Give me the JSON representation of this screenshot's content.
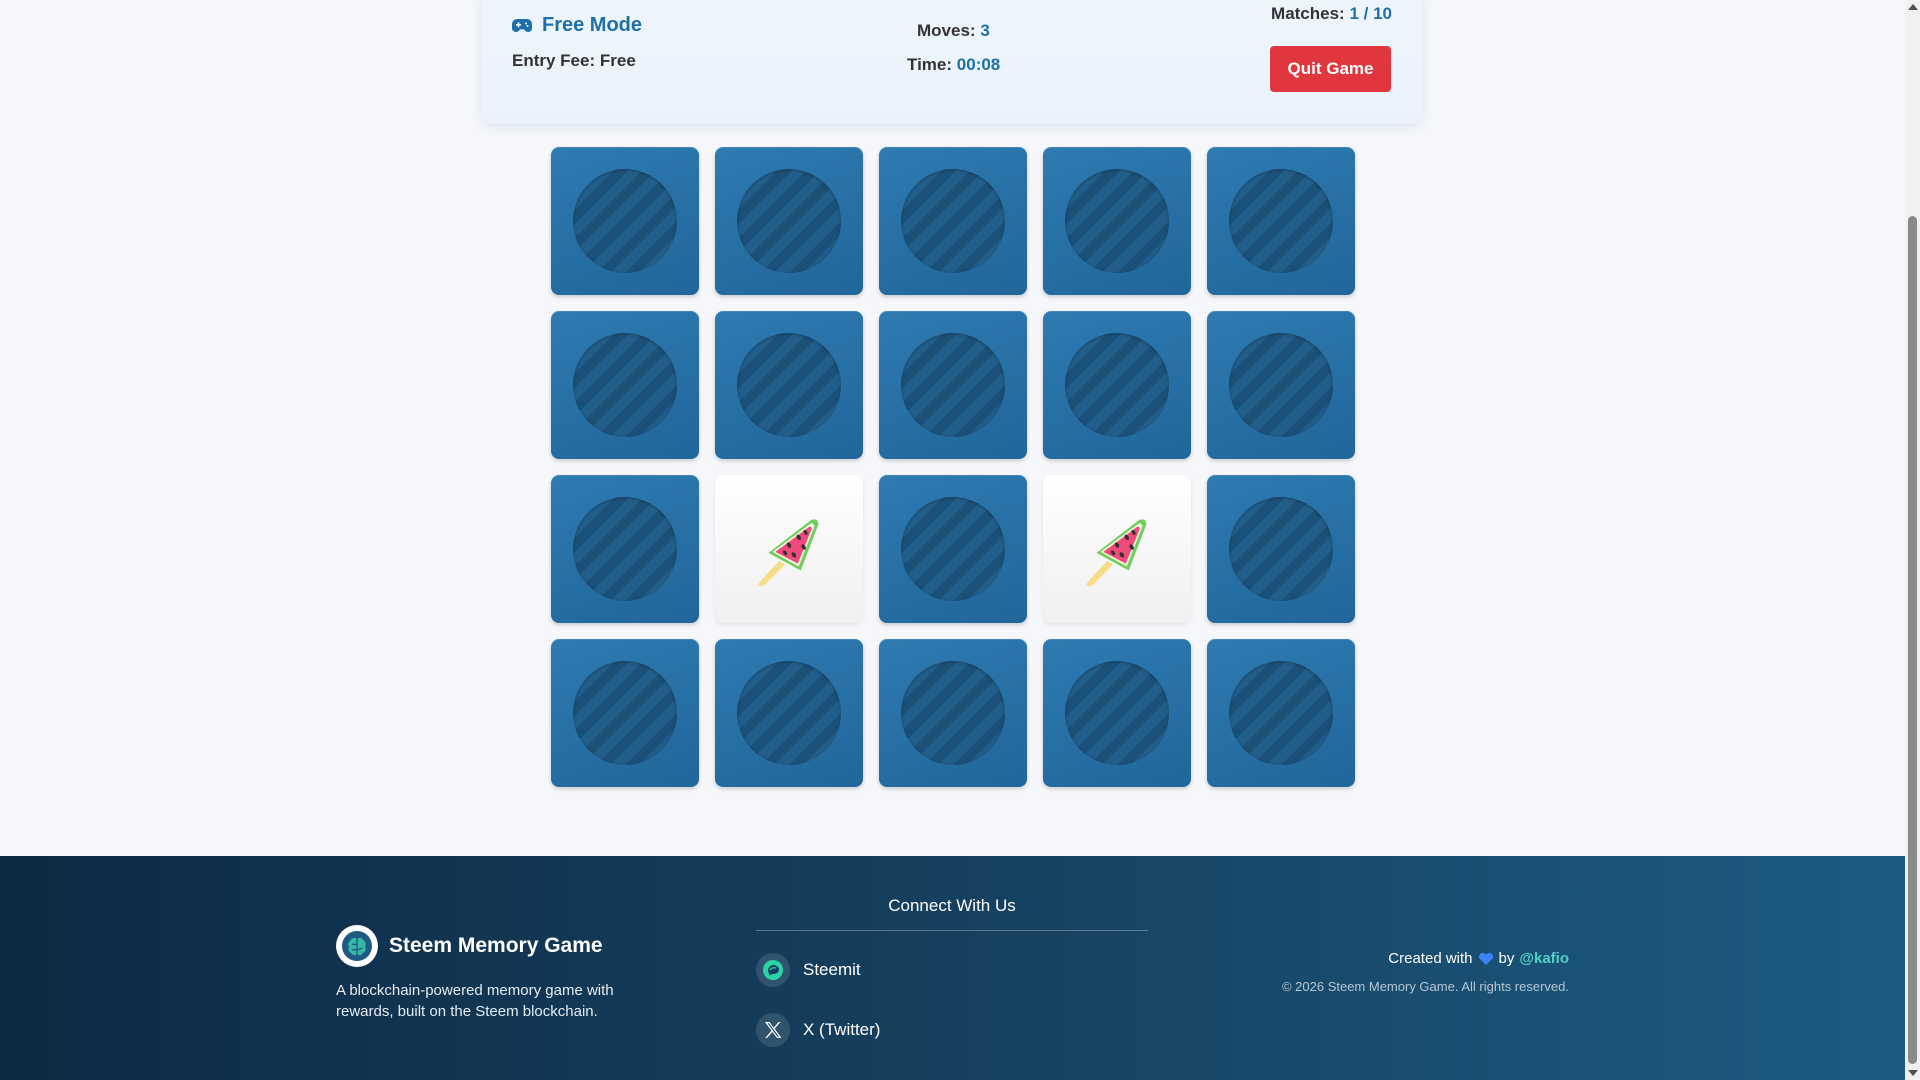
{
  "status": {
    "mode_title": "Free Mode",
    "entry_fee_label": "Entry Fee:",
    "entry_fee_value": "Free",
    "moves_label": "Moves:",
    "moves_value": "3",
    "time_label": "Time:",
    "time_value": "00:08",
    "matches_label": "Matches:",
    "matches_value": "1 / 10",
    "quit_label": "Quit Game"
  },
  "board": {
    "columns": 5,
    "rows": 4,
    "cards": [
      {
        "state": "hidden"
      },
      {
        "state": "hidden"
      },
      {
        "state": "hidden"
      },
      {
        "state": "hidden"
      },
      {
        "state": "hidden"
      },
      {
        "state": "hidden"
      },
      {
        "state": "hidden"
      },
      {
        "state": "hidden"
      },
      {
        "state": "hidden"
      },
      {
        "state": "hidden"
      },
      {
        "state": "hidden"
      },
      {
        "state": "revealed",
        "icon": "watermelon-icon"
      },
      {
        "state": "hidden"
      },
      {
        "state": "revealed",
        "icon": "watermelon-icon"
      },
      {
        "state": "hidden"
      },
      {
        "state": "hidden"
      },
      {
        "state": "hidden"
      },
      {
        "state": "hidden"
      },
      {
        "state": "hidden"
      },
      {
        "state": "hidden"
      }
    ]
  },
  "footer": {
    "brand_name": "Steem Memory Game",
    "brand_desc": "A blockchain-powered memory game with rewards, built on the Steem blockchain.",
    "connect_title": "Connect With Us",
    "social": [
      {
        "label": "Steemit",
        "icon": "steemit-icon"
      },
      {
        "label": "X (Twitter)",
        "icon": "x-twitter-icon"
      }
    ],
    "credit_prefix": "Created with",
    "credit_by": "by",
    "credit_author": "@kafio",
    "copyright": "© 2026 Steem Memory Game. All rights reserved."
  },
  "colors": {
    "accent": "#1e6fa8",
    "quit_button": "#e0363d",
    "card_back": "#2a76ad",
    "footer_bg": "#16405f",
    "author_link": "#4fd1c5"
  }
}
